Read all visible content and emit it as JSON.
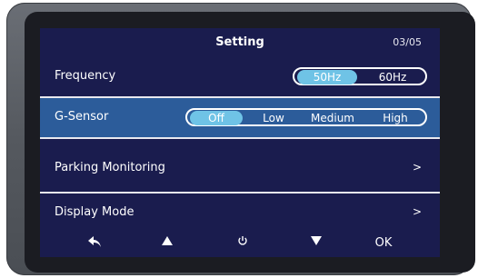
{
  "header": {
    "title": "Setting",
    "page": "03/05"
  },
  "rows": [
    {
      "label": "Frequency",
      "options": [
        "50Hz",
        "60Hz"
      ],
      "selected": "50Hz"
    },
    {
      "label": "G-Sensor",
      "options": [
        "Off",
        "Low",
        "Medium",
        "High"
      ],
      "selected": "Off"
    },
    {
      "label": "Parking Monitoring",
      "chevron": ">"
    },
    {
      "label": "Display Mode",
      "chevron": ">"
    }
  ],
  "navbar": {
    "ok_label": "OK"
  },
  "colors": {
    "screen_bg": "#1a1c4e",
    "selected_row": "#2c5c9a",
    "active_option": "#6fc3e6"
  }
}
